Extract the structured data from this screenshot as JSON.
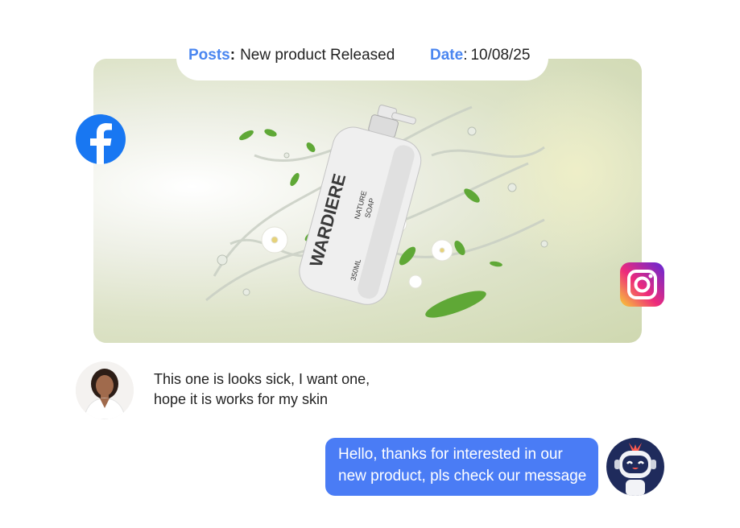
{
  "post": {
    "posts_label": "Posts",
    "posts_value": "New product Released",
    "date_label": "Date",
    "date_value": "10/08/25",
    "product": {
      "brand": "WARDIERE",
      "subtitle_line1": "NATURE",
      "subtitle_line2": "SOAP",
      "volume": "350ML"
    }
  },
  "social": {
    "left_icon": "facebook-icon",
    "right_icon": "instagram-icon",
    "facebook_color": "#1877F2",
    "instagram_colors": [
      "#F9CE34",
      "#EE2A7B",
      "#6228D7"
    ]
  },
  "comments": {
    "user_comment_line1": "This one is looks sick, I want one,",
    "user_comment_line2": "hope it is works for my skin",
    "reply_line1": "Hello, thanks for interested in our",
    "reply_line2": "new product, pls check our message",
    "reply_color": "#4A7CF5"
  },
  "accent": "#4A86F0"
}
